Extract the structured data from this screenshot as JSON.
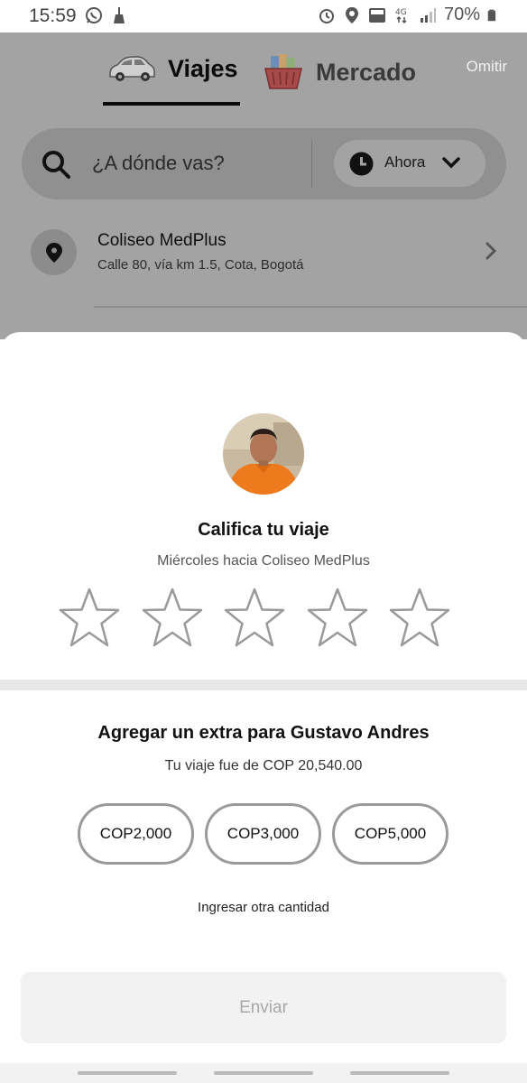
{
  "status_bar": {
    "time": "15:59",
    "battery": "70%",
    "left_icons": [
      "whatsapp-icon",
      "broom-icon"
    ],
    "right_icons": [
      "alarm-icon",
      "location-icon",
      "volte-icon",
      "4g-icon",
      "signal-icon",
      "battery-icon"
    ]
  },
  "tabs": [
    {
      "label": "Viajes",
      "icon": "car-icon",
      "active": true
    },
    {
      "label": "Mercado",
      "icon": "basket-icon",
      "active": false
    }
  ],
  "skip_label": "Omitir",
  "search": {
    "placeholder": "¿A dónde vas?",
    "time_label": "Ahora"
  },
  "recent_place": {
    "title": "Coliseo MedPlus",
    "address": "Calle 80, vía km 1.5, Cota, Bogotá"
  },
  "rating": {
    "title": "Califica tu viaje",
    "subtitle": "Miércoles hacia Coliseo MedPlus",
    "stars_total": 5,
    "stars_selected": 0
  },
  "tip": {
    "title": "Agregar un extra para Gustavo Andres",
    "subtitle": "Tu viaje fue de COP 20,540.00",
    "options": [
      "COP2,000",
      "COP3,000",
      "COP5,000"
    ],
    "other_amount_label": "Ingresar otra cantidad"
  },
  "submit_label": "Enviar",
  "colors": {
    "overlay_bg": "#a3a3a3",
    "sheet_bg": "#ffffff",
    "star_outline": "#9a9a9a",
    "disabled_button_bg": "#f2f2f2",
    "disabled_button_text": "#a8a8a8"
  }
}
